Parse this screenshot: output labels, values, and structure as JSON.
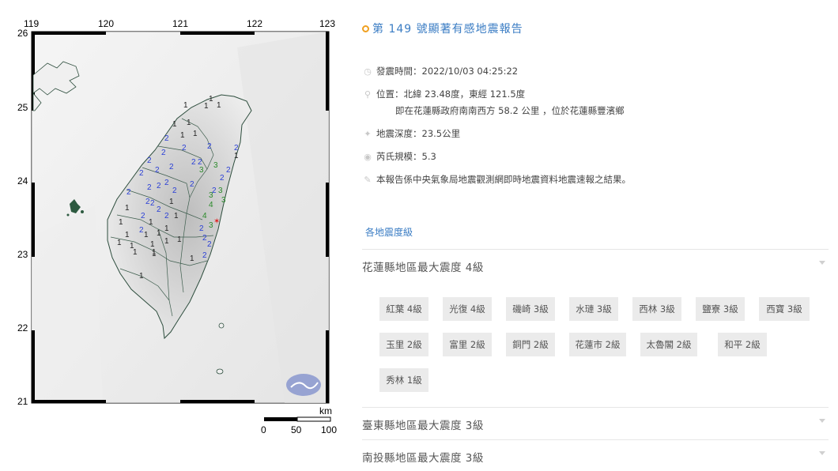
{
  "map": {
    "lon_labels": [
      "119",
      "120",
      "121",
      "122",
      "123"
    ],
    "lat_labels": [
      "26",
      "25",
      "24",
      "23",
      "22",
      "21"
    ],
    "scale_unit": "km",
    "scale_labels": [
      "0",
      "50",
      "100"
    ],
    "intensity_colors": {
      "1": "#222222",
      "2": "#2a3fd6",
      "3": "#2a8a2a",
      "4": "#2a8a2a"
    },
    "epicenter_color": "#e02020"
  },
  "report": {
    "title": "第 149 號顯著有感地震報告",
    "time": "發震時間：2022/10/03 04:25:22",
    "location": "位置：北緯 23.48度，東經 121.5度",
    "location_detail": "即在花蓮縣政府南南西方 58.2 公里 ，位於花蓮縣豐濱鄉",
    "depth": "地震深度：23.5公里",
    "magnitude": "芮氏規模：5.3",
    "note": "本報告係中央氣象局地震觀測網即時地震資料地震速報之結果。",
    "section_title": "各地震度級",
    "counties": [
      {
        "name": "花蓮縣地區最大震度 4級"
      },
      {
        "name": "臺東縣地區最大震度 3級"
      },
      {
        "name": "南投縣地區最大震度 3級"
      }
    ],
    "stations": [
      "紅葉 4級",
      "光復 4級",
      "磯崎 3級",
      "水璉 3級",
      "西林 3級",
      "鹽寮 3級",
      "西寶 3級",
      "玉里 2級",
      "富里 2級",
      "銅門 2級",
      "花蓮市 2級",
      "太魯閣 2級",
      "和平 2級",
      "秀林 1級"
    ]
  }
}
